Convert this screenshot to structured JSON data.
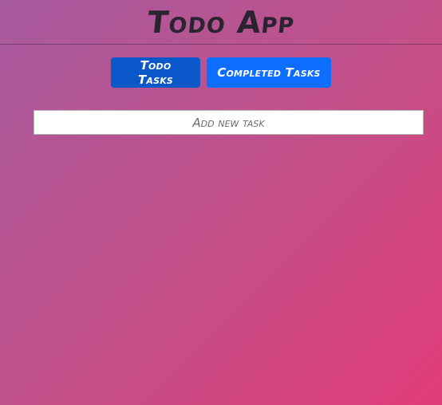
{
  "app": {
    "title": "Todo App"
  },
  "tabs": [
    {
      "label": "Todo Tasks",
      "active": true
    },
    {
      "label": "Completed Tasks",
      "active": false
    }
  ],
  "new_task": {
    "placeholder": "Add new task",
    "value": ""
  },
  "colors": {
    "background_start": "#a65a9e",
    "background_end": "#e03c78",
    "tab_active": "#0a58ca",
    "tab_inactive": "#0d6efd",
    "title_text": "#2b2430"
  }
}
